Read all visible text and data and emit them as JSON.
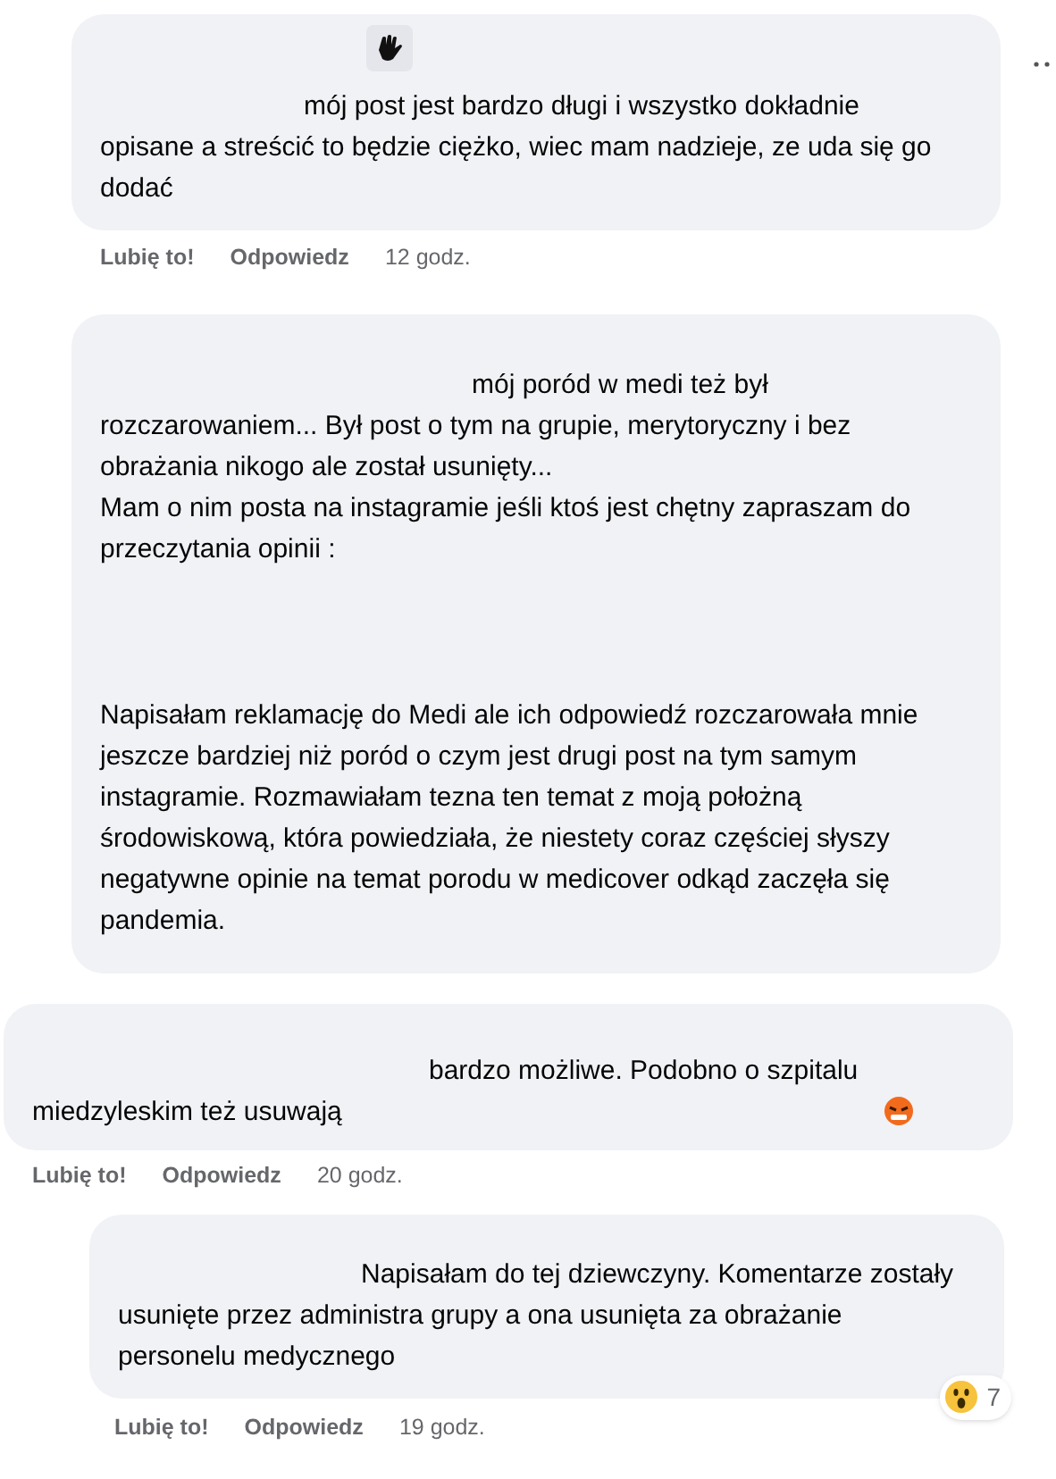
{
  "comments": [
    {
      "kind": "sticker",
      "paragraphs": [
        "mój post jest bardzo długi i wszystko dokładnie opisane a streścić to będzie ciężko, wiec mam nadzieje, ze uda się go dodać"
      ],
      "actions": {
        "like": "Lubię to!",
        "reply": "Odpowiedz",
        "time": "12 godz."
      }
    },
    {
      "kind": "plain",
      "paragraphs": [
        "mój poród w medi też był rozczarowaniem... Był post o tym na grupie, merytoryczny i bez obrażania nikogo ale został usunięty...",
        "Mam o nim posta na instagramie jeśli ktoś jest chętny zapraszam do przeczytania opinii :",
        "Napisałam reklamację do Medi ale ich odpowiedź rozczarowała mnie jeszcze bardziej niż poród o czym jest drugi post na tym samym instagramie. Rozmawiałam tezna ten temat z moją położną środowiskową, która powiedziała, że niestety coraz częściej słyszy negatywne opinie na temat porodu w medicover odkąd zaczęła się pandemia."
      ]
    },
    {
      "kind": "emoji",
      "paragraphs": [
        "bardzo możliwe. Podobno o szpitalu miedzyleskim też usuwają"
      ],
      "actions": {
        "like": "Lubię to!",
        "reply": "Odpowiedz",
        "time": "20 godz."
      }
    },
    {
      "kind": "plain",
      "paragraphs": [
        "Napisałam do tej dziewczyny. Komentarze zostały usunięte przez administra grupy a ona usunięta za obrażanie personelu medycznego"
      ],
      "actions": {
        "like": "Lubię to!",
        "reply": "Odpowiedz",
        "time": "19 godz."
      },
      "reactions": {
        "count": "7"
      }
    }
  ]
}
